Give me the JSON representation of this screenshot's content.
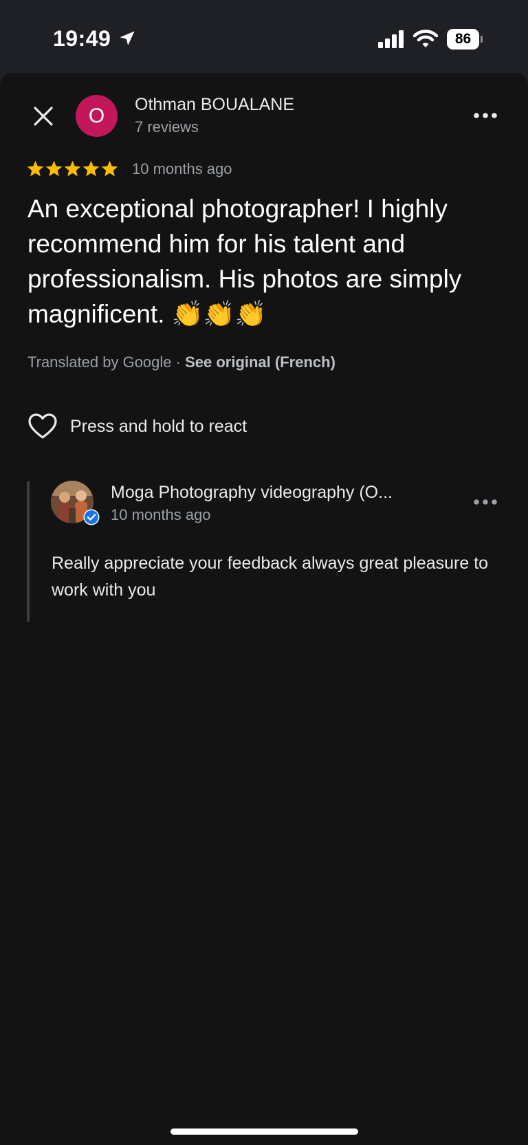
{
  "status_bar": {
    "time": "19:49",
    "battery": "86",
    "icons": [
      "location-arrow-icon",
      "cellular-signal-icon",
      "wifi-icon",
      "battery-icon"
    ]
  },
  "review": {
    "avatar_letter": "O",
    "avatar_color": "#c2185b",
    "reviewer_name": "Othman BOUALANE",
    "reviewer_meta": "7 reviews",
    "rating": 5,
    "rating_max": 5,
    "star_color": "#fbbc04",
    "time_ago": "10 months ago",
    "text": "An exceptional photographer! I highly recommend him for his talent and professionalism. His photos are simply magnificent. 👏👏👏",
    "translated_prefix": "Translated by Google · ",
    "see_original": "See original (French)",
    "react_label": "Press and hold to react"
  },
  "owner_reply": {
    "name": "Moga Photography videography (O...",
    "time_ago": "10 months ago",
    "text": "Really appreciate your feedback always great pleasure to work with you",
    "verified_color": "#1a73e8"
  }
}
